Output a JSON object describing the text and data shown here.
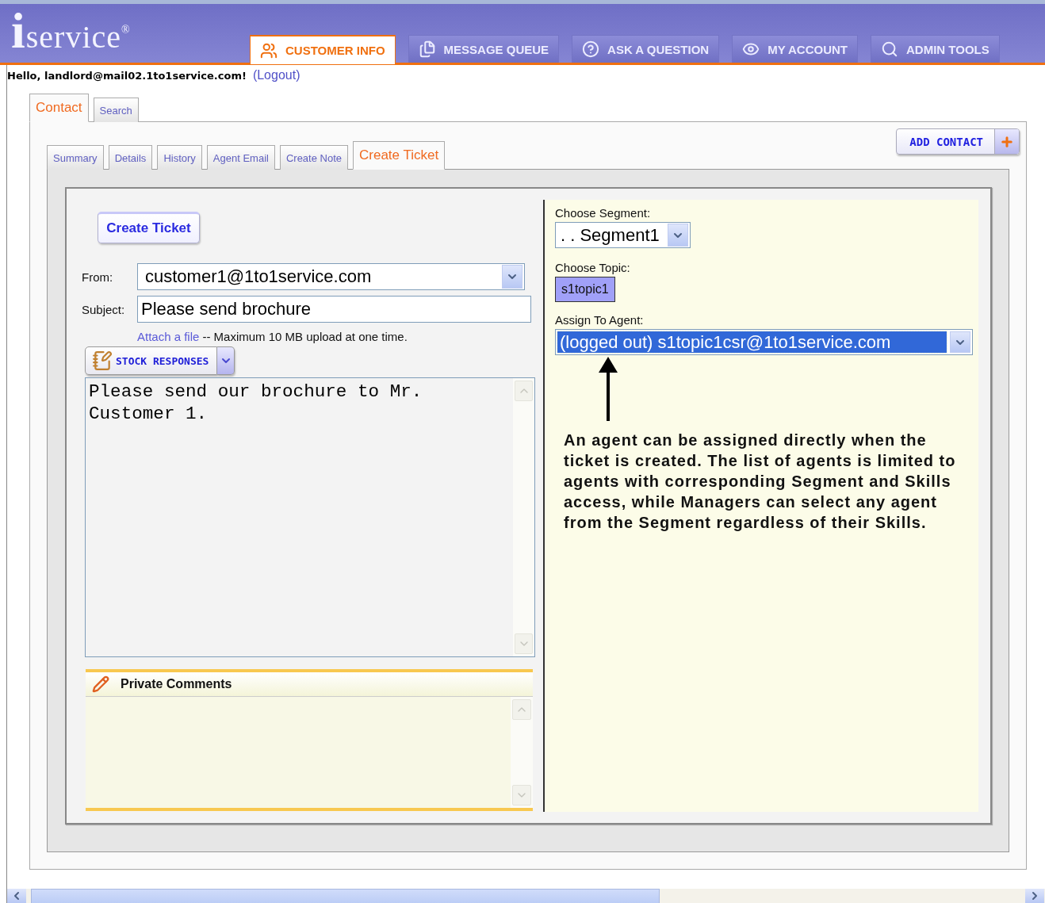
{
  "header": {
    "logo": "iservice$^{®}$",
    "nav_tabs": [
      {
        "label": "CUSTOMER INFO",
        "selected": true
      },
      {
        "label": "MESSAGE QUEUE",
        "selected": false
      },
      {
        "label": "ASK A QUESTION",
        "selected": false
      },
      {
        "label": "MY ACCOUNT",
        "selected": false
      },
      {
        "label": "ADMIN TOOLS",
        "selected": false
      }
    ]
  },
  "greeting": {
    "text": "Hello, landlord@mail02.1to1service.com!",
    "logout": "(Logout)"
  },
  "contact_tabs": [
    {
      "label": "Contact",
      "selected": true
    },
    {
      "label": "Search",
      "selected": false
    }
  ],
  "detail_tabs": [
    {
      "label": "Summary",
      "selected": false
    },
    {
      "label": "Details",
      "selected": false
    },
    {
      "label": "History",
      "selected": false
    },
    {
      "label": "Agent Email",
      "selected": false
    },
    {
      "label": "Create Note",
      "selected": false
    },
    {
      "label": "Create Ticket",
      "selected": true
    }
  ],
  "add_contact_button": "ADD CONTACT",
  "ticket_form": {
    "submit_button": "Create Ticket",
    "from": {
      "label": "From:",
      "value": "customer1@1to1service.com"
    },
    "subject": {
      "label": "Subject:",
      "value": "Please send brochure"
    },
    "attachment": {
      "link": "Attach a file",
      "note": "-- Maximum 10 MB upload at one time."
    },
    "stock_responses_button": "STOCK RESPONSES",
    "message": "Please send our brochure to Mr. Customer 1.",
    "private_comments": {
      "title": "Private Comments"
    }
  },
  "assignment": {
    "segment": {
      "label": "Choose Segment:",
      "value": ". . Segment1"
    },
    "topic": {
      "label": "Choose Topic:",
      "options": [
        {
          "label": "s1topic1",
          "selected": true
        }
      ]
    },
    "agent": {
      "label": "Assign To Agent:",
      "value": "(logged out) s1topic1csr@1to1service.com",
      "highlighted": true
    }
  },
  "annotation": "An agent can be assigned directly when the ticket is created. The list of agents is limited to agents with corresponding Segment and Skills access, while Managers can select any agent from the Segment regardless of their Skills."
}
